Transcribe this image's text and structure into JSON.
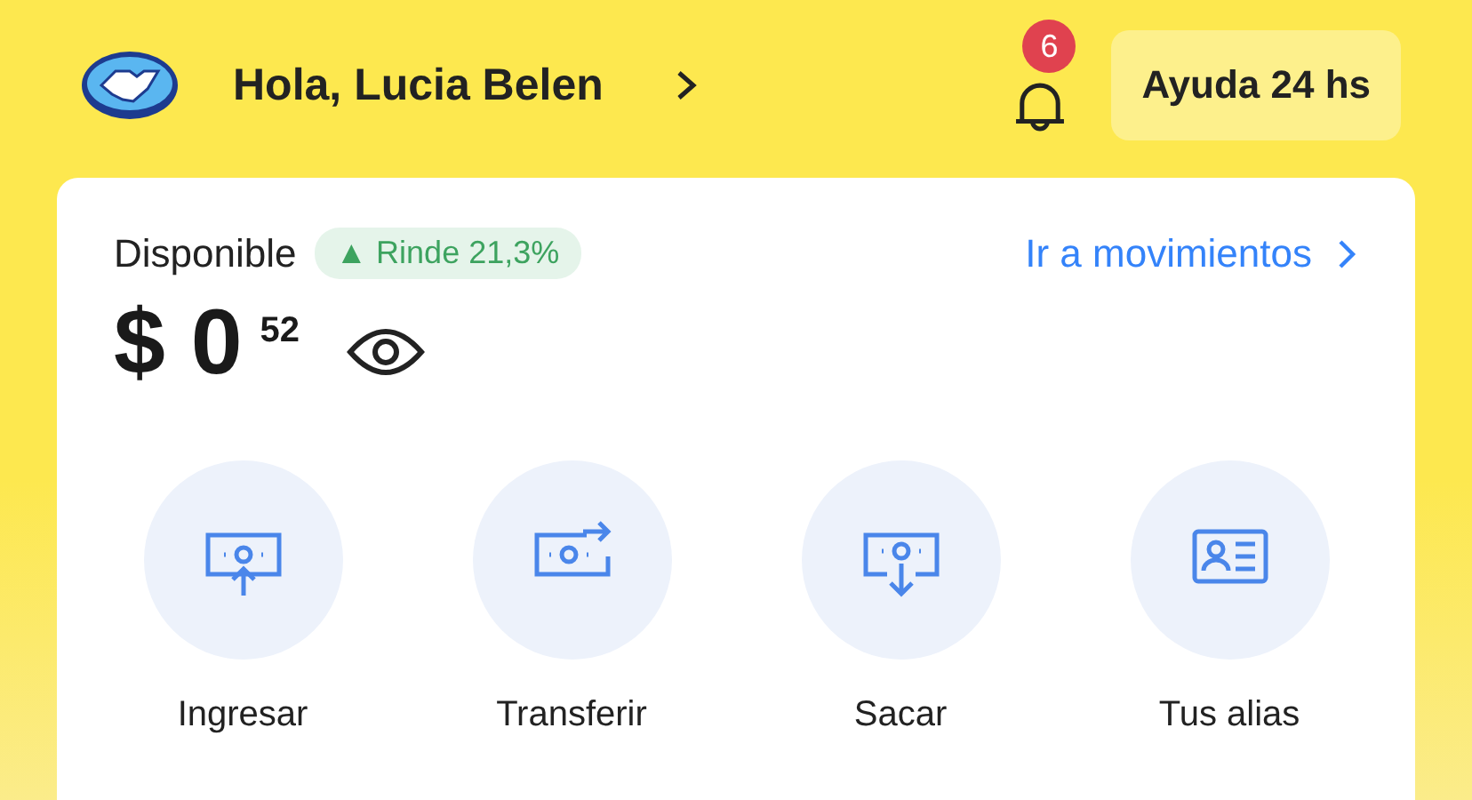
{
  "header": {
    "greeting": "Hola, Lucia Belen",
    "notifications": "6",
    "help_button": "Ayuda 24 hs"
  },
  "balance_card": {
    "label": "Disponible",
    "yield_badge": "▲ Rinde 21,3%",
    "link": "Ir a movimientos",
    "amount": "$ 0",
    "cents": "52",
    "actions": [
      {
        "kind": "deposit",
        "label": "Ingresar"
      },
      {
        "kind": "transfer",
        "label": "Transferir"
      },
      {
        "kind": "withdraw",
        "label": "Sacar"
      },
      {
        "kind": "alias",
        "label": "Tus alias"
      }
    ]
  }
}
